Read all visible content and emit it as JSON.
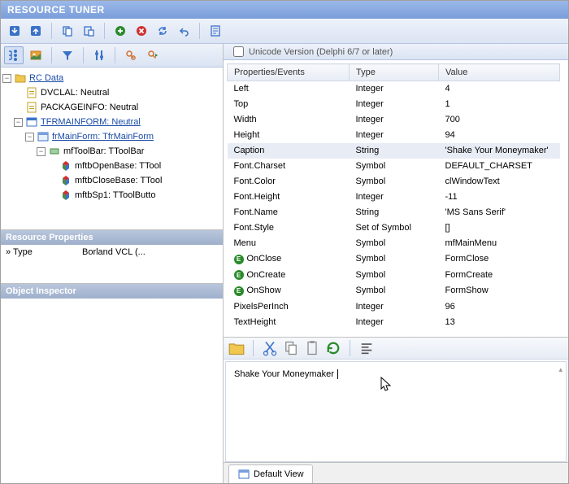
{
  "title": "RESOURCE TUNER",
  "unicode_label": "Unicode Version (Delphi 6/7 or later)",
  "tree": {
    "root": "RC Data",
    "items": [
      "DVCLAL: Neutral",
      "PACKAGEINFO: Neutral",
      "TFRMAINFORM: Neutral",
      "frMainForm: TfrMainForm",
      "mfToolBar: TToolBar",
      "mftbOpenBase: TTool",
      "mftbCloseBase: TTool",
      "mftbSp1: TToolButto"
    ]
  },
  "panels": {
    "res_props": "Resource Properties",
    "inspector": "Object Inspector",
    "type_key": "Type",
    "type_val": "Borland VCL (...",
    "type_prefix": "»"
  },
  "headers": {
    "c1": "Properties/Events",
    "c2": "Type",
    "c3": "Value"
  },
  "rows": [
    {
      "n": "Left",
      "t": "Integer",
      "v": "4",
      "e": false
    },
    {
      "n": "Top",
      "t": "Integer",
      "v": "1",
      "e": false
    },
    {
      "n": "Width",
      "t": "Integer",
      "v": "700",
      "e": false
    },
    {
      "n": "Height",
      "t": "Integer",
      "v": "94",
      "e": false
    },
    {
      "n": "Caption",
      "t": "String",
      "v": "'Shake Your Moneymaker'",
      "e": false,
      "sel": true
    },
    {
      "n": "Font.Charset",
      "t": "Symbol",
      "v": "DEFAULT_CHARSET",
      "e": false
    },
    {
      "n": "Font.Color",
      "t": "Symbol",
      "v": "clWindowText",
      "e": false
    },
    {
      "n": "Font.Height",
      "t": "Integer",
      "v": "-11",
      "e": false
    },
    {
      "n": "Font.Name",
      "t": "String",
      "v": "'MS Sans Serif'",
      "e": false
    },
    {
      "n": "Font.Style",
      "t": "Set of Symbol",
      "v": "[]",
      "e": false
    },
    {
      "n": "Menu",
      "t": "Symbol",
      "v": "mfMainMenu",
      "e": false
    },
    {
      "n": "OnClose",
      "t": "Symbol",
      "v": "FormClose",
      "e": true
    },
    {
      "n": "OnCreate",
      "t": "Symbol",
      "v": "FormCreate",
      "e": true
    },
    {
      "n": "OnShow",
      "t": "Symbol",
      "v": "FormShow",
      "e": true
    },
    {
      "n": "PixelsPerInch",
      "t": "Integer",
      "v": "96",
      "e": false
    },
    {
      "n": "TextHeight",
      "t": "Integer",
      "v": "13",
      "e": false
    }
  ],
  "editor_text": "Shake Your Moneymaker",
  "tab_label": "Default View",
  "event_marker": "E"
}
